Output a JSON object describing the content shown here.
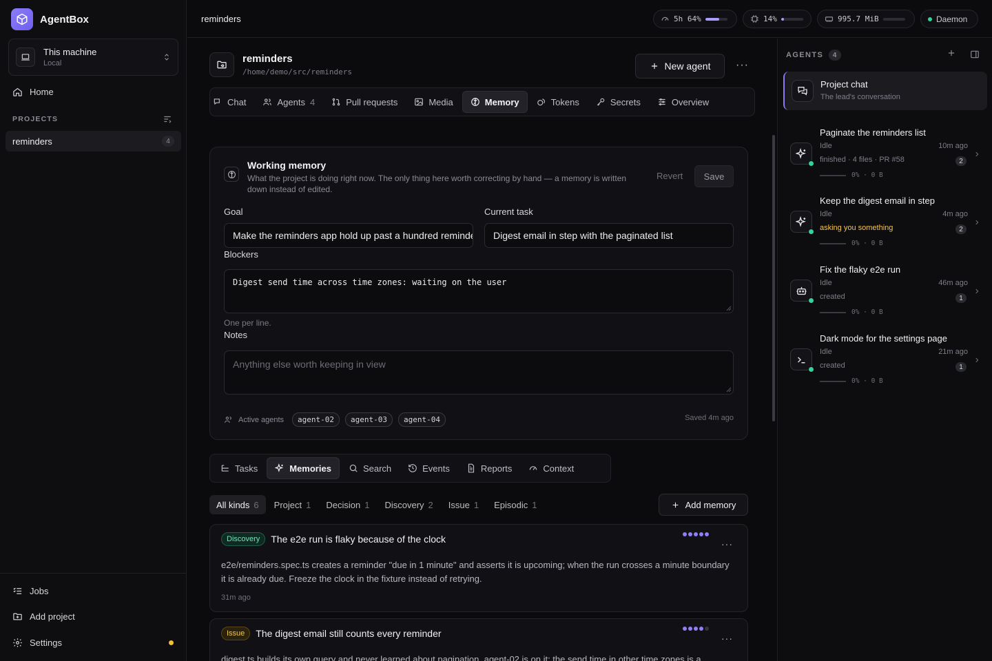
{
  "app": {
    "name": "AgentBox"
  },
  "machine": {
    "title": "This machine",
    "subtitle": "Local"
  },
  "nav": {
    "home": "Home",
    "projects_heading": "PROJECTS"
  },
  "projects": [
    {
      "name": "reminders",
      "count": "4"
    }
  ],
  "sidebar_bottom": {
    "jobs": "Jobs",
    "add_project": "Add project",
    "settings": "Settings"
  },
  "topbar": {
    "title": "reminders",
    "stats": [
      {
        "label": "5h 64%",
        "progress": 0.64
      },
      {
        "label": "14%",
        "progress": 0.14
      },
      {
        "label": "995.7 MiB",
        "progress": 0.0
      },
      {
        "label": "Daemon"
      }
    ]
  },
  "project": {
    "name": "reminders",
    "path": "/home/demo/src/reminders",
    "new_agent": "New agent",
    "more": "···"
  },
  "tabs": [
    {
      "label": "Chat",
      "count": ""
    },
    {
      "label": "Agents",
      "count": "4"
    },
    {
      "label": "Pull requests",
      "count": ""
    },
    {
      "label": "Media",
      "count": ""
    },
    {
      "label": "Memory",
      "count": ""
    },
    {
      "label": "Tokens",
      "count": ""
    },
    {
      "label": "Secrets",
      "count": ""
    },
    {
      "label": "Overview",
      "count": ""
    }
  ],
  "working_memory": {
    "title": "Working memory",
    "description": "What the project is doing right now. The only thing here worth correcting by hand — a memory is written down instead of edited.",
    "revert": "Revert",
    "save": "Save",
    "goal_label": "Goal",
    "goal_value": "Make the reminders app hold up past a hundred reminders",
    "task_label": "Current task",
    "task_value": "Digest email in step with the paginated list",
    "blockers_label": "Blockers",
    "blockers_value": "Digest send time across time zones: waiting on the user",
    "blockers_hint": "One per line.",
    "notes_label": "Notes",
    "notes_placeholder": "Anything else worth keeping in view",
    "active_agents_label": "Active agents",
    "active_agents": [
      "agent-02",
      "agent-03",
      "agent-04"
    ],
    "saved": "Saved 4m ago"
  },
  "subtabs": [
    {
      "label": "Tasks"
    },
    {
      "label": "Memories"
    },
    {
      "label": "Search"
    },
    {
      "label": "Events"
    },
    {
      "label": "Reports"
    },
    {
      "label": "Context"
    }
  ],
  "filters": [
    {
      "label": "All kinds",
      "count": "6"
    },
    {
      "label": "Project",
      "count": "1"
    },
    {
      "label": "Decision",
      "count": "1"
    },
    {
      "label": "Discovery",
      "count": "2"
    },
    {
      "label": "Issue",
      "count": "1"
    },
    {
      "label": "Episodic",
      "count": "1"
    }
  ],
  "add_memory": "Add memory",
  "memories": [
    {
      "kind": "Discovery",
      "title": "The e2e run is flaky because of the clock",
      "body": "e2e/reminders.spec.ts creates a reminder \"due in 1 minute\" and asserts it is upcoming; when the run crosses a minute boundary it is already due. Freeze the clock in the fixture instead of retrying.",
      "time": "31m ago",
      "importance": 5
    },
    {
      "kind": "Issue",
      "title": "The digest email still counts every reminder",
      "body": "digest.ts builds its own query and never learned about pagination. agent-02 is on it; the send time in other time zones is a",
      "importance": 4
    }
  ],
  "agents_panel": {
    "heading": "AGENTS",
    "count": "4",
    "chat": {
      "title": "Project chat",
      "subtitle": "The lead's conversation"
    },
    "agents": [
      {
        "title": "Paginate the reminders list",
        "state": "Idle",
        "time": "10m ago",
        "detail": "finished · 4 files · PR #58",
        "num": "2",
        "progress": "0% · 0 B",
        "icon": "sparkle-icon"
      },
      {
        "title": "Keep the digest email in step",
        "state": "Idle",
        "time": "4m ago",
        "detail": "asking you something",
        "num": "2",
        "progress": "0% · 0 B",
        "icon": "sparkle-icon"
      },
      {
        "title": "Fix the flaky e2e run",
        "state": "Idle",
        "time": "46m ago",
        "detail": "created",
        "num": "1",
        "progress": "0% · 0 B",
        "icon": "robot-icon"
      },
      {
        "title": "Dark mode for the settings page",
        "state": "Idle",
        "time": "21m ago",
        "detail": "created",
        "num": "1",
        "progress": "0% · 0 B",
        "icon": "terminal-icon"
      }
    ]
  },
  "colors": {
    "accent": "#8b7cf6",
    "success": "#34d399",
    "warning": "#f5c451"
  }
}
